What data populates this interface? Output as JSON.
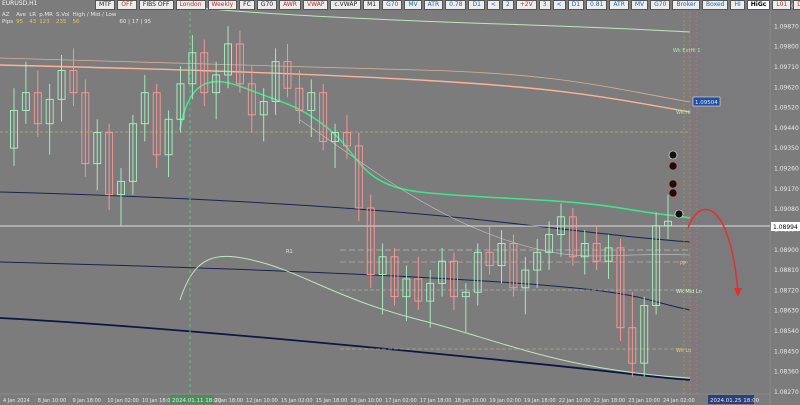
{
  "symbol_title": "EURUSD,H1",
  "toolbar": [
    {
      "label": "MTF",
      "style": "normal"
    },
    {
      "label": "OFF",
      "style": "red"
    },
    {
      "label": "FIBS OFF",
      "style": "normal"
    },
    {
      "label": "London",
      "style": "red"
    },
    {
      "label": "Weekly",
      "style": "red"
    },
    {
      "label": "FC",
      "style": "normal"
    },
    {
      "label": "G70",
      "style": "normal"
    },
    {
      "label": "AWR",
      "style": "red"
    },
    {
      "label": "VWAP",
      "style": "red"
    },
    {
      "label": "c.VWAP",
      "style": "normal"
    },
    {
      "label": "M1",
      "style": "normal"
    },
    {
      "label": "G70",
      "style": "blue"
    },
    {
      "label": "MV",
      "style": "blue"
    },
    {
      "label": "ATR",
      "style": "blue"
    },
    {
      "label": "0.78",
      "style": "blue"
    },
    {
      "label": "D1",
      "style": "blue"
    },
    {
      "label": "<",
      "style": "blue"
    },
    {
      "label": "2",
      "style": "blue"
    },
    {
      "label": "+2V",
      "style": "red"
    },
    {
      "label": "3",
      "style": "blue"
    },
    {
      "label": "<",
      "style": "blue"
    },
    {
      "label": "D1",
      "style": "blue"
    },
    {
      "label": "0.81",
      "style": "blue"
    },
    {
      "label": "ATR",
      "style": "blue"
    },
    {
      "label": "MV",
      "style": "blue"
    },
    {
      "label": "G70",
      "style": "blue"
    },
    {
      "label": "Broker",
      "style": "blue"
    },
    {
      "label": "Boxed",
      "style": "blue"
    },
    {
      "label": "HI",
      "style": "blue"
    },
    {
      "label": "HiGc",
      "style": "hl"
    },
    {
      "label": "L01",
      "style": "red"
    },
    {
      "label": "D1",
      "style": "red"
    },
    {
      "label": "RA",
      "style": "normal"
    },
    {
      "label": "FFR",
      "style": "normal"
    }
  ],
  "stats": {
    "headers": [
      "AZ",
      "Ave",
      "LR",
      "p.MR",
      "S.Vol",
      "High / Mid / Low"
    ],
    "rows": [
      [
        "Pips",
        "95",
        "43",
        "123",
        "235",
        "56",
        "60 | 17 | 95"
      ]
    ]
  },
  "price_axis": [
    "1.09800",
    "1.09870",
    "1.09800",
    "1.09710",
    "1.09620",
    "1.09520",
    "1.09440",
    "1.09350",
    "1.09260",
    "1.09170",
    "1.09080",
    "1.08994",
    "1.08900",
    "1.08810",
    "1.08720",
    "1.08630",
    "1.08540",
    "1.08450",
    "1.08360",
    "1.08270"
  ],
  "current_price": "1.08994",
  "highlight_price": "1.09504",
  "time_axis": [
    "4 Jan 2024",
    "8 Jan 10:00",
    "9 Jan 18:00",
    "10 Jan 02:00",
    "10 Jan 18:00",
    "11 Jan 10:00",
    "12 Jan 18:00",
    "12 Jan 10:00",
    "15 Jan 02:00",
    "15 Jan 18:00",
    "16 Jan 10:00",
    "17 Jan 02:00",
    "17 Jan 18:00",
    "18 Jan 10:00",
    "19 Jan 02:00",
    "19 Jan 18:00",
    "22 Jan 10:00",
    "22 Jan 18:00",
    "23 Jan 10:00",
    "24 Jan 02:00"
  ],
  "time_highlight": "2024.01.11 18:00",
  "time_highlight_right": "2024.01.25 18:00",
  "level_labels": {
    "wk_r1": "Wk ExtHi 1",
    "wk_hi": "Wk Hi",
    "r1": "R1",
    "pp": "PP",
    "wk_mid": "Wk Mid Ln",
    "wk_lo": "Wk Lo"
  },
  "chart_data": {
    "type": "candlestick",
    "candles": [
      [
        1.0933,
        1.096,
        1.0925,
        1.095
      ],
      [
        1.095,
        1.0972,
        1.0944,
        1.0958
      ],
      [
        1.0958,
        1.0968,
        1.0938,
        1.0944
      ],
      [
        1.0944,
        1.0962,
        1.093,
        1.0955
      ],
      [
        1.0955,
        1.0975,
        1.0945,
        1.0968
      ],
      [
        1.0968,
        1.0978,
        1.0952,
        1.0958
      ],
      [
        1.0958,
        1.0964,
        1.092,
        1.0926
      ],
      [
        1.0926,
        1.0946,
        1.0914,
        1.094
      ],
      [
        1.094,
        1.0944,
        1.0905,
        1.0912
      ],
      [
        1.0912,
        1.0924,
        1.0898,
        1.0918
      ],
      [
        1.0918,
        1.0948,
        1.0912,
        1.0944
      ],
      [
        1.0944,
        1.0966,
        1.0936,
        1.0958
      ],
      [
        1.0958,
        1.0962,
        1.0924,
        1.093
      ],
      [
        1.093,
        1.095,
        1.092,
        1.0946
      ],
      [
        1.0946,
        1.097,
        1.094,
        1.0962
      ],
      [
        1.0962,
        1.0984,
        1.0955,
        1.0976
      ],
      [
        1.0976,
        1.0982,
        1.0952,
        1.0958
      ],
      [
        1.0958,
        1.0972,
        1.0946,
        1.0966
      ],
      [
        1.0966,
        1.0988,
        1.096,
        1.098
      ],
      [
        1.098,
        1.0986,
        1.0958,
        1.0962
      ],
      [
        1.0962,
        1.097,
        1.094,
        1.0948
      ],
      [
        1.0948,
        1.096,
        1.0936,
        1.0954
      ],
      [
        1.0954,
        1.0978,
        1.0948,
        1.0972
      ],
      [
        1.0972,
        1.098,
        1.0956,
        1.096
      ],
      [
        1.096,
        1.0968,
        1.0944,
        1.095
      ],
      [
        1.095,
        1.0964,
        1.0938,
        1.0958
      ],
      [
        1.0958,
        1.0962,
        1.0932,
        1.0936
      ],
      [
        1.0936,
        1.0944,
        1.0924,
        1.094
      ],
      [
        1.094,
        1.0948,
        1.0928,
        1.0934
      ],
      [
        1.0934,
        1.094,
        1.09,
        1.0906
      ],
      [
        1.0906,
        1.0912,
        1.087,
        1.0876
      ],
      [
        1.0876,
        1.089,
        1.0858,
        1.0884
      ],
      [
        1.0884,
        1.0888,
        1.0862,
        1.0866
      ],
      [
        1.0866,
        1.088,
        1.0855,
        1.0874
      ],
      [
        1.0874,
        1.0884,
        1.086,
        1.0864
      ],
      [
        1.0864,
        1.0878,
        1.0852,
        1.0872
      ],
      [
        1.0872,
        1.0888,
        1.0866,
        1.0882
      ],
      [
        1.0882,
        1.0886,
        1.086,
        1.0866
      ],
      [
        1.0866,
        1.0872,
        1.085,
        1.0868
      ],
      [
        1.0868,
        1.089,
        1.0862,
        1.0886
      ],
      [
        1.0886,
        1.0898,
        1.0876,
        1.088
      ],
      [
        1.088,
        1.0896,
        1.0872,
        1.089
      ],
      [
        1.089,
        1.0894,
        1.0866,
        1.087
      ],
      [
        1.087,
        1.0884,
        1.0858,
        1.0878
      ],
      [
        1.0878,
        1.0892,
        1.087,
        1.0886
      ],
      [
        1.0886,
        1.09,
        1.0878,
        1.0894
      ],
      [
        1.0894,
        1.0908,
        1.0884,
        1.0902
      ],
      [
        1.0902,
        1.0906,
        1.088,
        1.0884
      ],
      [
        1.0884,
        1.0896,
        1.0876,
        1.089
      ],
      [
        1.089,
        1.0898,
        1.0878,
        1.0882
      ],
      [
        1.0882,
        1.0894,
        1.0874,
        1.0888
      ],
      [
        1.0888,
        1.0892,
        1.0846,
        1.0852
      ],
      [
        1.0852,
        1.0868,
        1.083,
        1.0836
      ],
      [
        1.0836,
        1.0866,
        1.083,
        1.0862
      ],
      [
        1.0862,
        1.0904,
        1.0858,
        1.0898
      ],
      [
        1.0898,
        1.0912,
        1.0892,
        1.09
      ]
    ]
  }
}
